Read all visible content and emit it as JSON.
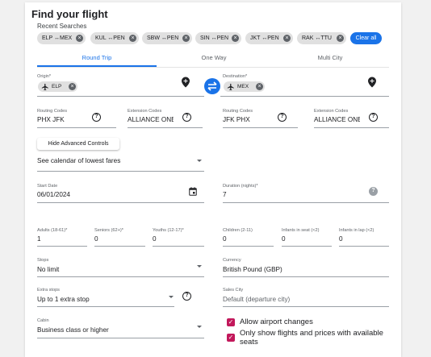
{
  "title": "Find your flight",
  "recent_label": "Recent Searches",
  "recent": [
    {
      "label": "ELP ↔MEX"
    },
    {
      "label": "KUL ↔PEN"
    },
    {
      "label": "SBW ↔PEN"
    },
    {
      "label": "SIN ↔PEN"
    },
    {
      "label": "JKT ↔PEN"
    },
    {
      "label": "RAK ↔TTU"
    }
  ],
  "clear_all": "Clear all",
  "tabs": [
    "Round Trip",
    "One Way",
    "Multi City"
  ],
  "origin": {
    "label": "Origin*",
    "chip": "ELP"
  },
  "destination": {
    "label": "Destination*",
    "chip": "MEX"
  },
  "routing1": {
    "label": "Routing Codes",
    "value": "PHX JFK"
  },
  "extension1": {
    "label": "Extension Codes",
    "value": "ALLIANCE ONE"
  },
  "routing2": {
    "label": "Routing Codes",
    "value": "JFK PHX"
  },
  "extension2": {
    "label": "Extension Codes",
    "value": "ALLIANCE ONE"
  },
  "advanced_button": "Hide Advanced Controls",
  "calendar_select": "See calendar of lowest fares",
  "start_date": {
    "label": "Start Date",
    "value": "06/01/2024"
  },
  "duration": {
    "label": "Duration (nights)*",
    "value": "7"
  },
  "passengers": [
    {
      "label": "Adults (18-61)*",
      "value": "1"
    },
    {
      "label": "Seniors (62+)*",
      "value": "0"
    },
    {
      "label": "Youths (12-17)*",
      "value": "0"
    },
    {
      "label": "Children (2-11)",
      "value": "0"
    },
    {
      "label": "Infants in seat (<2)",
      "value": "0"
    },
    {
      "label": "Infants in lap (<2)",
      "value": "0"
    }
  ],
  "stops": {
    "label": "Stops",
    "value": "No limit"
  },
  "currency": {
    "label": "Currency",
    "value": "British Pound (GBP)"
  },
  "extra_stops": {
    "label": "Extra stops",
    "value": "Up to 1 extra stop"
  },
  "sales_city": {
    "label": "Sales City",
    "placeholder": "Default (departure city)"
  },
  "cabin": {
    "label": "Cabin",
    "value": "Business class or higher"
  },
  "checkboxes": [
    {
      "label": "Allow airport changes",
      "checked": true
    },
    {
      "label": "Only show flights and prices with available seats",
      "checked": true
    }
  ],
  "colors": {
    "accent": "#1a73e8",
    "checkbox": "#c2185b"
  }
}
